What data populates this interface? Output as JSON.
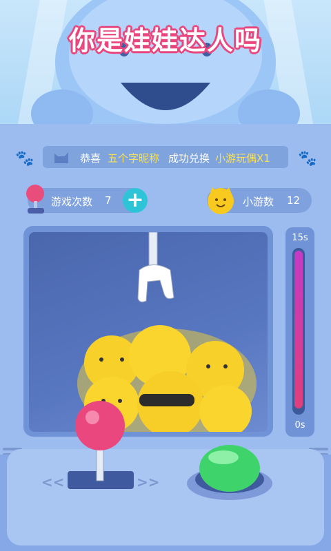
{
  "header": {
    "title": "你是娃娃达人吗"
  },
  "message": {
    "prefix": "恭喜",
    "nickname": "五个字昵称",
    "middle": "成功兑换",
    "prize": "小游玩偶X1",
    "highlight_color": "#f6e05a",
    "text_color": "#ffffff"
  },
  "stats": {
    "plays_label": "游戏次数",
    "plays_value": "7",
    "coins_label": "小游数",
    "coins_value": "12"
  },
  "timer": {
    "max_label": "15s",
    "min_label": "0s",
    "level": 0.98
  },
  "controls": {
    "left_chevrons": "<<",
    "right_chevrons": ">>"
  },
  "icons": {
    "paw": "paw-icon",
    "cat_avatar": "cat-avatar-icon",
    "joystick": "joystick-icon",
    "add": "plus-icon",
    "coin_mascot": "mascot-coin-icon"
  }
}
